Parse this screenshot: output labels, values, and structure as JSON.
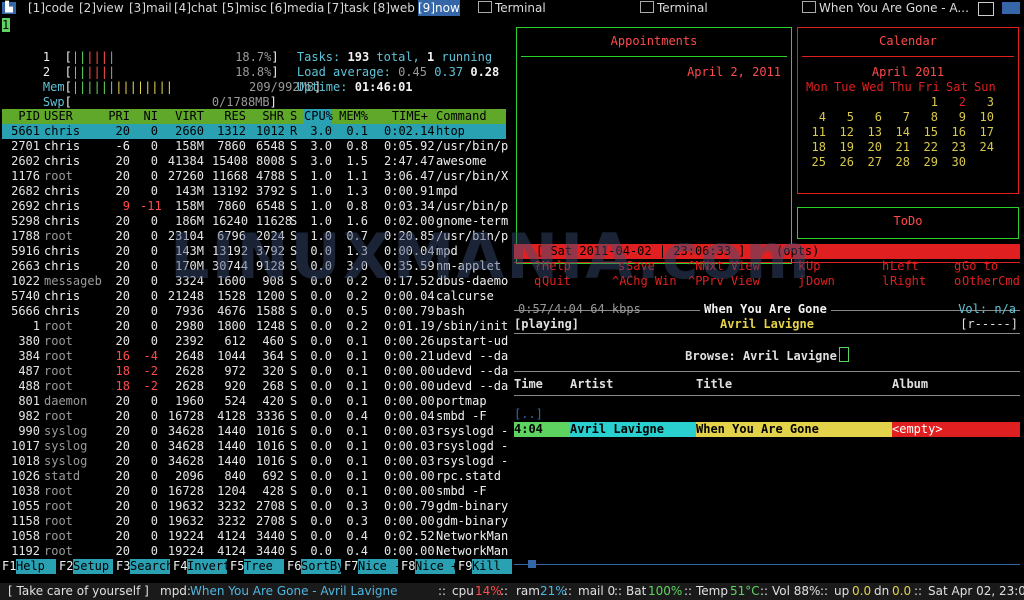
{
  "topbar": {
    "tags": [
      "[1]code",
      "[2]view",
      "[3]mail",
      "[4]chat",
      "[5]misc",
      "[6]media",
      "[7]task",
      "[8]web",
      "[9]now"
    ],
    "selected_tag": "[9]now",
    "tasks": [
      "Terminal",
      "Terminal",
      "When You Are Gone - A..."
    ]
  },
  "htop": {
    "cursor": "1",
    "cpu1_label": "1",
    "cpu1_value": "18.7%",
    "cpu2_label": "2",
    "cpu2_value": "18.8%",
    "mem_label": "Mem",
    "mem_value": "209/992MB",
    "swp_label": "Swp",
    "swp_value": "0/1788MB",
    "tasks_label": "Tasks:",
    "tasks_total": "193",
    "tasks_total_label": "total,",
    "tasks_running": "1",
    "tasks_running_label": "running",
    "load_label": "Load average:",
    "load1": "0.45",
    "load5": "0.37",
    "load15": "0.28",
    "uptime_label": "Uptime:",
    "uptime": "01:46:01",
    "headers": [
      "PID",
      "USER",
      "PRI",
      "NI",
      "VIRT",
      "RES",
      "SHR",
      "S",
      "CPU%",
      "MEM%",
      "TIME+",
      "Command"
    ],
    "processes": [
      [
        "5661",
        "chris",
        "20",
        "0",
        "2660",
        "1312",
        "1012",
        "R",
        "3.0",
        "0.1",
        "0:02.14",
        "htop"
      ],
      [
        "2701",
        "chris",
        "-6",
        "0",
        "158M",
        "7860",
        "6548",
        "S",
        "3.0",
        "0.8",
        "0:05.92",
        "/usr/bin/p"
      ],
      [
        "2602",
        "chris",
        "20",
        "0",
        "41384",
        "15408",
        "8008",
        "S",
        "3.0",
        "1.5",
        "2:47.47",
        "awesome"
      ],
      [
        "1176",
        "root",
        "20",
        "0",
        "27260",
        "11668",
        "4788",
        "S",
        "1.0",
        "1.1",
        "3:06.47",
        "/usr/bin/X"
      ],
      [
        "2682",
        "chris",
        "20",
        "0",
        "143M",
        "13192",
        "3792",
        "S",
        "1.0",
        "1.3",
        "0:00.91",
        "mpd"
      ],
      [
        "2692",
        "chris",
        "9",
        "-11",
        "158M",
        "7860",
        "6548",
        "S",
        "1.0",
        "0.8",
        "0:03.34",
        "/usr/bin/p"
      ],
      [
        "5298",
        "chris",
        "20",
        "0",
        "186M",
        "16240",
        "11628",
        "S",
        "1.0",
        "1.6",
        "0:02.00",
        "gnome-term"
      ],
      [
        "1788",
        "root",
        "20",
        "0",
        "23104",
        "6796",
        "2024",
        "S",
        "1.0",
        "0.7",
        "0:20.85",
        "/usr/bin/p"
      ],
      [
        "5916",
        "chris",
        "20",
        "0",
        "143M",
        "13192",
        "3792",
        "S",
        "0.0",
        "1.3",
        "0:00.04",
        "mpd"
      ],
      [
        "2663",
        "chris",
        "20",
        "0",
        "170M",
        "30744",
        "9128",
        "S",
        "0.0",
        "3.0",
        "0:35.59",
        "nm-applet"
      ],
      [
        "1022",
        "messageb",
        "20",
        "0",
        "3324",
        "1600",
        "908",
        "S",
        "0.0",
        "0.2",
        "0:17.52",
        "dbus-daemo"
      ],
      [
        "5740",
        "chris",
        "20",
        "0",
        "21248",
        "1528",
        "1200",
        "S",
        "0.0",
        "0.2",
        "0:00.04",
        "calcurse"
      ],
      [
        "5666",
        "chris",
        "20",
        "0",
        "7936",
        "4676",
        "1588",
        "S",
        "0.0",
        "0.5",
        "0:00.79",
        "bash"
      ],
      [
        "1",
        "root",
        "20",
        "0",
        "2980",
        "1800",
        "1248",
        "S",
        "0.0",
        "0.2",
        "0:01.19",
        "/sbin/init"
      ],
      [
        "380",
        "root",
        "20",
        "0",
        "2392",
        "612",
        "460",
        "S",
        "0.0",
        "0.1",
        "0:00.26",
        "upstart-ud"
      ],
      [
        "384",
        "root",
        "16",
        "-4",
        "2648",
        "1044",
        "364",
        "S",
        "0.0",
        "0.1",
        "0:00.21",
        "udevd --da"
      ],
      [
        "487",
        "root",
        "18",
        "-2",
        "2628",
        "972",
        "320",
        "S",
        "0.0",
        "0.1",
        "0:00.00",
        "udevd --da"
      ],
      [
        "488",
        "root",
        "18",
        "-2",
        "2628",
        "920",
        "268",
        "S",
        "0.0",
        "0.1",
        "0:00.00",
        "udevd --da"
      ],
      [
        "801",
        "daemon",
        "20",
        "0",
        "1960",
        "524",
        "420",
        "S",
        "0.0",
        "0.1",
        "0:00.00",
        "portmap"
      ],
      [
        "982",
        "root",
        "20",
        "0",
        "16728",
        "4128",
        "3336",
        "S",
        "0.0",
        "0.4",
        "0:00.04",
        "smbd -F"
      ],
      [
        "990",
        "syslog",
        "20",
        "0",
        "34628",
        "1440",
        "1016",
        "S",
        "0.0",
        "0.1",
        "0:00.03",
        "rsyslogd -"
      ],
      [
        "1017",
        "syslog",
        "20",
        "0",
        "34628",
        "1440",
        "1016",
        "S",
        "0.0",
        "0.1",
        "0:00.03",
        "rsyslogd -"
      ],
      [
        "1018",
        "syslog",
        "20",
        "0",
        "34628",
        "1440",
        "1016",
        "S",
        "0.0",
        "0.1",
        "0:00.03",
        "rsyslogd -"
      ],
      [
        "1026",
        "statd",
        "20",
        "0",
        "2096",
        "840",
        "692",
        "S",
        "0.0",
        "0.1",
        "0:00.00",
        "rpc.statd"
      ],
      [
        "1038",
        "root",
        "20",
        "0",
        "16728",
        "1204",
        "428",
        "S",
        "0.0",
        "0.1",
        "0:00.00",
        "smbd -F"
      ],
      [
        "1055",
        "root",
        "20",
        "0",
        "19632",
        "3232",
        "2708",
        "S",
        "0.0",
        "0.3",
        "0:00.79",
        "gdm-binary"
      ],
      [
        "1158",
        "root",
        "20",
        "0",
        "19632",
        "3232",
        "2708",
        "S",
        "0.0",
        "0.3",
        "0:00.00",
        "gdm-binary"
      ],
      [
        "1058",
        "root",
        "20",
        "0",
        "19224",
        "4124",
        "3440",
        "S",
        "0.0",
        "0.4",
        "0:02.52",
        "NetworkMan"
      ],
      [
        "1192",
        "root",
        "20",
        "0",
        "19224",
        "4124",
        "3440",
        "S",
        "0.0",
        "0.4",
        "0:00.00",
        "NetworkMan"
      ]
    ],
    "fkeys": [
      {
        "key": "F1",
        "label": "Help  "
      },
      {
        "key": "F2",
        "label": "Setup "
      },
      {
        "key": "F3",
        "label": "Search"
      },
      {
        "key": "F4",
        "label": "Invert"
      },
      {
        "key": "F5",
        "label": "Tree  "
      },
      {
        "key": "F6",
        "label": "SortBy"
      },
      {
        "key": "F7",
        "label": "Nice -"
      },
      {
        "key": "F8",
        "label": "Nice +"
      },
      {
        "key": "F9",
        "label": "Kill  "
      }
    ]
  },
  "calcurse": {
    "appointments_title": "Appointments",
    "appointments_date": "April 2, 2011",
    "calendar_title": "Calendar",
    "calendar_month": "April 2011",
    "weekdays": [
      "Mon",
      "Tue",
      "Wed",
      "Thu",
      "Fri",
      "Sat",
      "Sun"
    ],
    "weeks": [
      [
        "",
        "",
        "",
        "",
        "1",
        "2",
        "3"
      ],
      [
        "4",
        "5",
        "6",
        "7",
        "8",
        "9",
        "10"
      ],
      [
        "11",
        "12",
        "13",
        "14",
        "15",
        "16",
        "17"
      ],
      [
        "18",
        "19",
        "20",
        "21",
        "22",
        "23",
        "24"
      ],
      [
        "25",
        "26",
        "27",
        "28",
        "29",
        "30",
        ""
      ]
    ],
    "today": "2",
    "todo_title": "ToDo",
    "status_line": "[ Sat 2011-04-02 | 23:06:33 ]",
    "status_opts": "(opts)",
    "keys": [
      {
        "key": "?",
        "label": "Help"
      },
      {
        "key": "s",
        "label": "Save"
      },
      {
        "key": "^N",
        "label": "Nxt View"
      },
      {
        "key": "k",
        "label": "Up"
      },
      {
        "key": "h",
        "label": "Left"
      },
      {
        "key": "g",
        "label": "Go to"
      },
      {
        "key": "q",
        "label": "Quit"
      },
      {
        "key": "^A",
        "label": "Chg Win"
      },
      {
        "key": "^P",
        "label": "Prv View"
      },
      {
        "key": "j",
        "label": "Down"
      },
      {
        "key": "l",
        "label": "Right"
      },
      {
        "key": "o",
        "label": "OtherCmd"
      }
    ]
  },
  "ncmpcpp": {
    "time_info": "0:57/4:04 64 kbps",
    "title": "When You Are Gone",
    "volume": "Vol: n/a",
    "state": "[playing]",
    "artist": "Avril Lavigne",
    "flags": "[r-----]",
    "browse_label": "Browse: Avril Lavigne",
    "columns": [
      "Time",
      "Artist",
      "Title",
      "Album"
    ],
    "parent_dir": "[..]",
    "track": {
      "time": "4:04",
      "artist": "Avril Lavigne",
      "title": "When You Are Gone",
      "album": "<empty>"
    }
  },
  "watermark": "LINUXMANIA.com",
  "statusbar": {
    "message": "[ Take care of yourself ]",
    "mpd_label": "mpd:",
    "mpd_song": "When You Are Gone - Avril Lavigne",
    "sep": "::",
    "cpu_label": "cpu",
    "cpu_value": "14%",
    "ram_label": "ram",
    "ram_value": "21%",
    "mail_label": "mail 0",
    "bat_label": "Bat",
    "bat_value": "100%",
    "temp_label": "Temp",
    "temp_value": "51°C",
    "vol_label": "Vol 88%",
    "up_label": "up",
    "up_value": "0.0",
    "dn_label": "dn",
    "dn_value": "0.0",
    "datetime": "Sat Apr 02, 23:06"
  },
  "colors": {
    "accent": "#3566a8",
    "htop_header": "#5fa82a",
    "cursor": "#2aa1b3",
    "calcurse_green": "#2bd12b",
    "calcurse_red": "#e02020"
  }
}
